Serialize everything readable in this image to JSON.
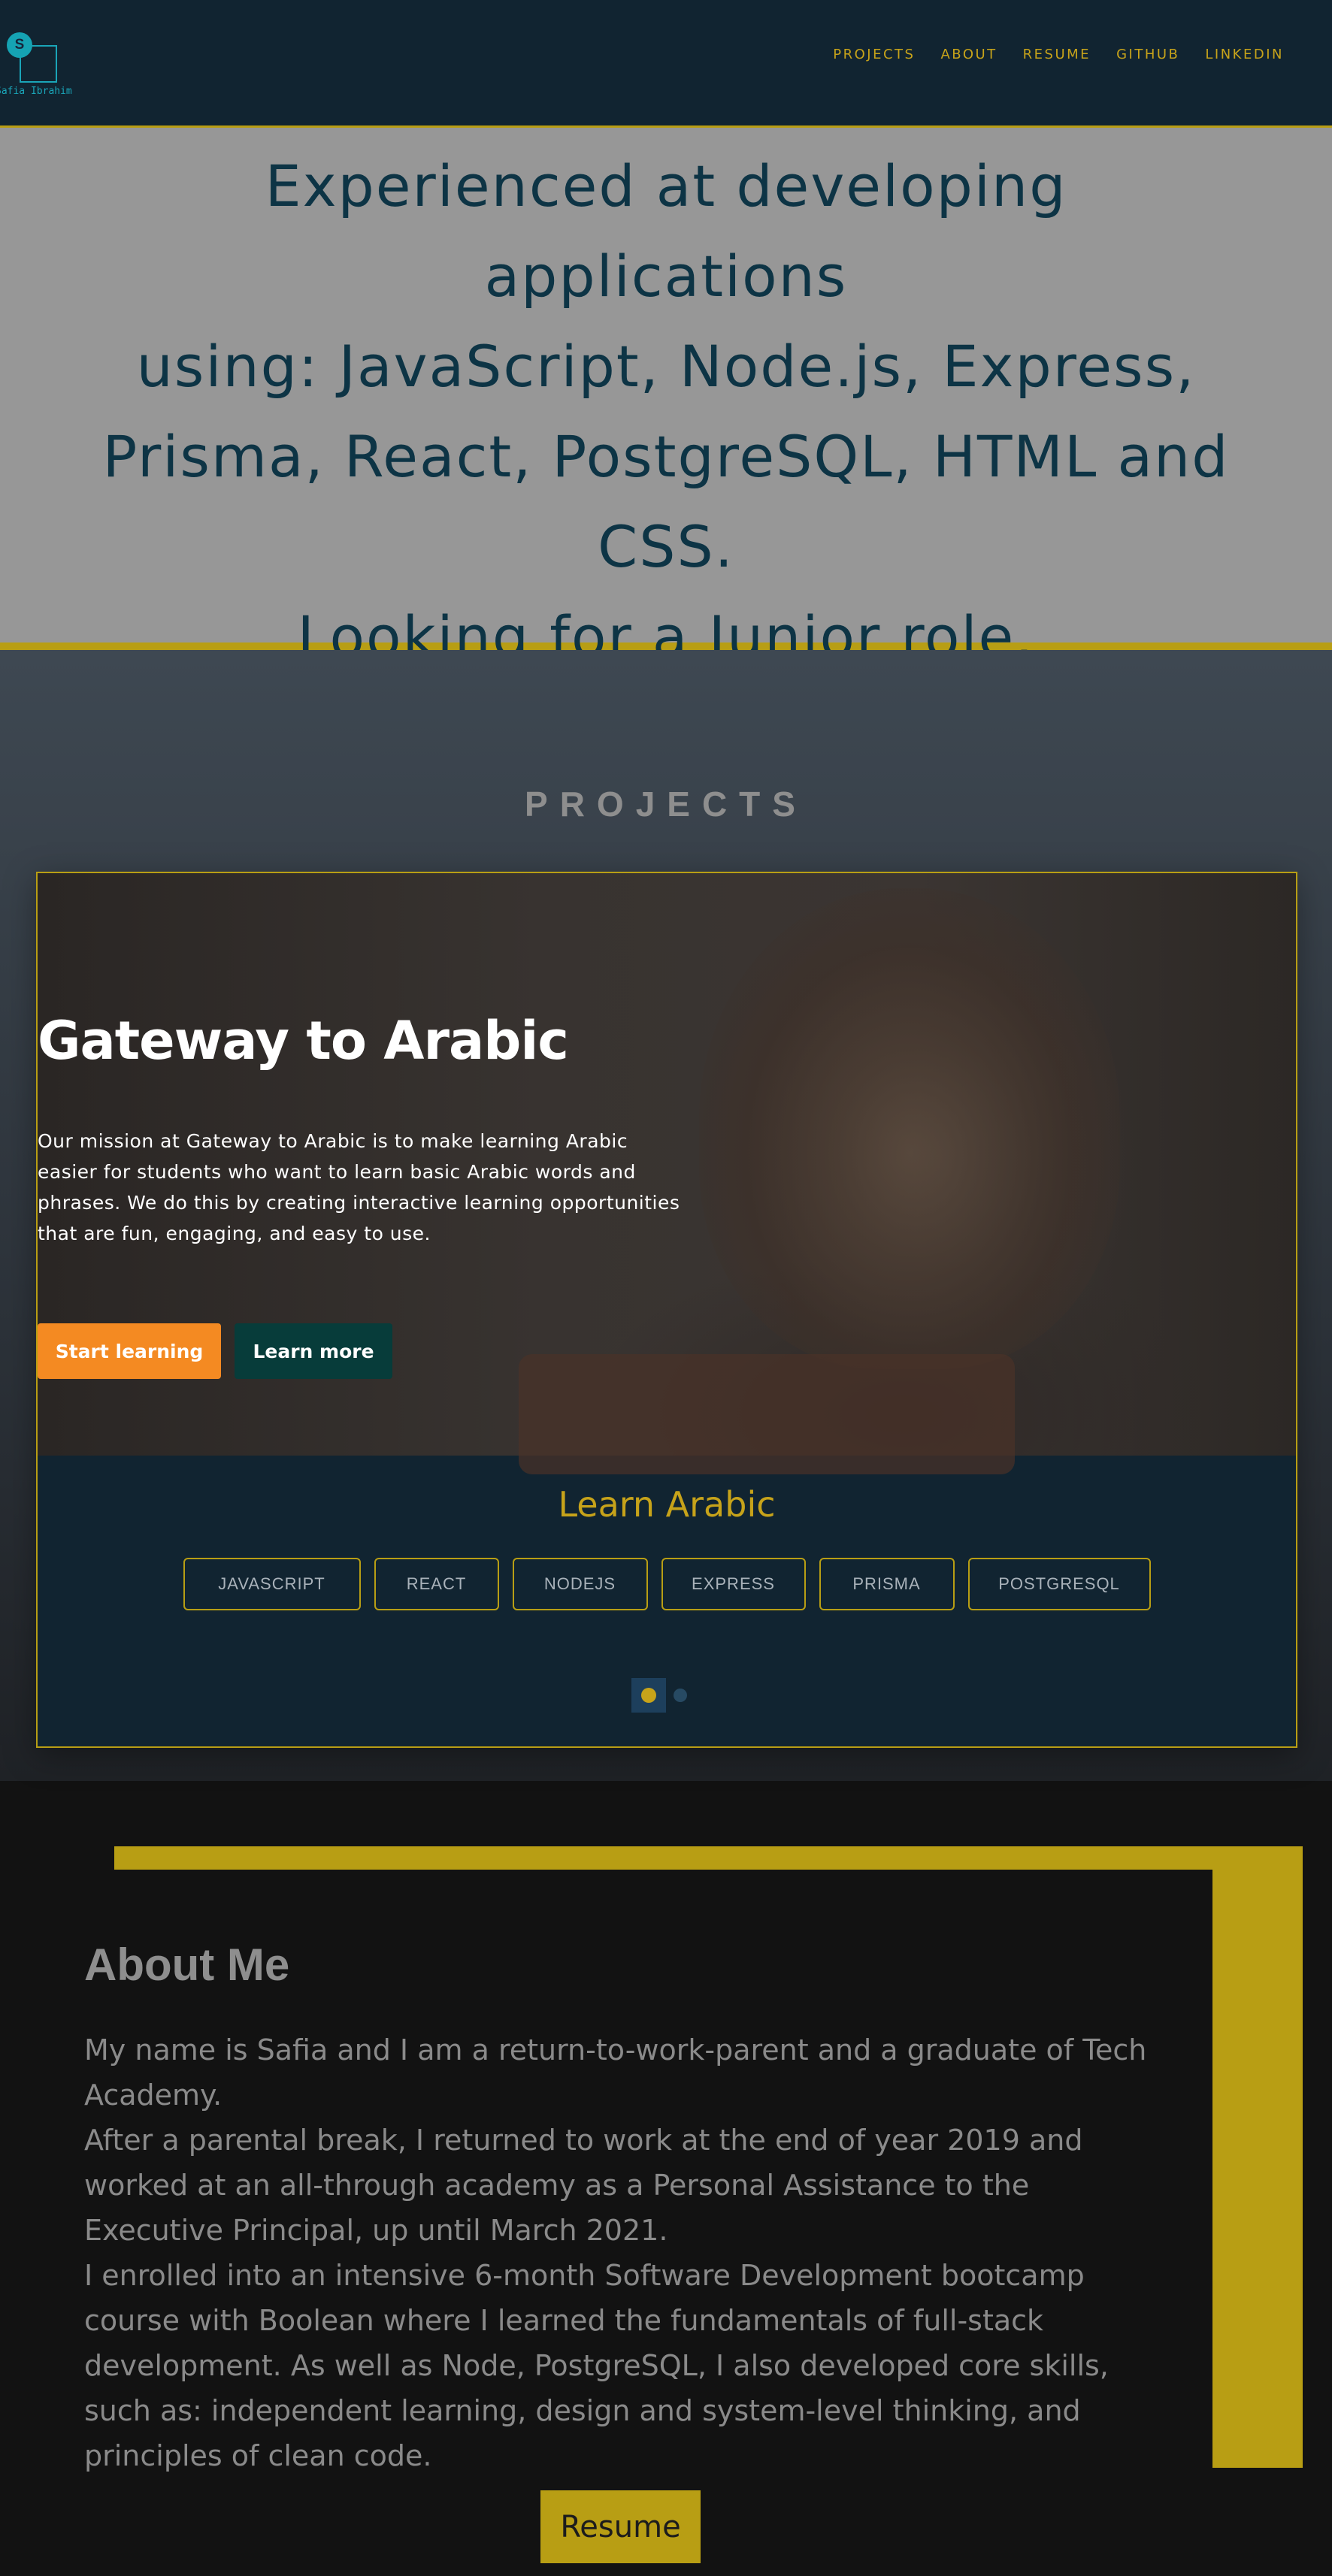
{
  "logo": {
    "initial": "S",
    "name": "Safia Ibrahim"
  },
  "nav": {
    "links": [
      "PROJECTS",
      "ABOUT",
      "RESUME",
      "GITHUB",
      "LINKEDIN"
    ]
  },
  "hero": {
    "lines": [
      "Experienced at developing applications",
      "using: JavaScript, Node.js, Express,",
      "Prisma, React, PostgreSQL, HTML and",
      "CSS.",
      "Looking for a Junior role."
    ]
  },
  "projects": {
    "title": "PROJECTS",
    "card": {
      "screenshot": {
        "title": "Gateway to Arabic",
        "text": "Our mission at Gateway to Arabic is to make learning Arabic easier for students who want to learn basic Arabic words and phrases. We do this by creating interactive learning opportunities that are fun, engaging, and easy to use.",
        "start_button": "Start learning",
        "more_button": "Learn more"
      },
      "name": "Learn Arabic",
      "tags": [
        "JAVASCRIPT",
        "REACT",
        "NODEJS",
        "EXPRESS",
        "PRISMA",
        "POSTGRESQL"
      ]
    },
    "carousel": {
      "current": 1,
      "total": 2
    }
  },
  "about": {
    "title": "About Me",
    "paragraphs": [
      "My name is Safia and I am a return-to-work-parent and a graduate of Tech Academy.",
      "After a parental break, I returned to work at the end of year 2019 and worked at an all-through academy as a Personal Assistance to the Executive Principal, up until March 2021.",
      "I enrolled into an intensive 6-month Software Development bootcamp course with Boolean where I learned the fundamentals of full-stack development. As well as Node, PostgreSQL, I also developed core skills, such as: independent learning, design and system-level thinking, and principles of clean code."
    ],
    "resume_button": "Resume"
  },
  "colors": {
    "nav_bg": "#112431",
    "accent_gold": "#b89e14",
    "hero_bg": "#979797",
    "hero_text": "#0d3445",
    "orange_button": "#f48a22",
    "teal_button": "#073c3a"
  }
}
